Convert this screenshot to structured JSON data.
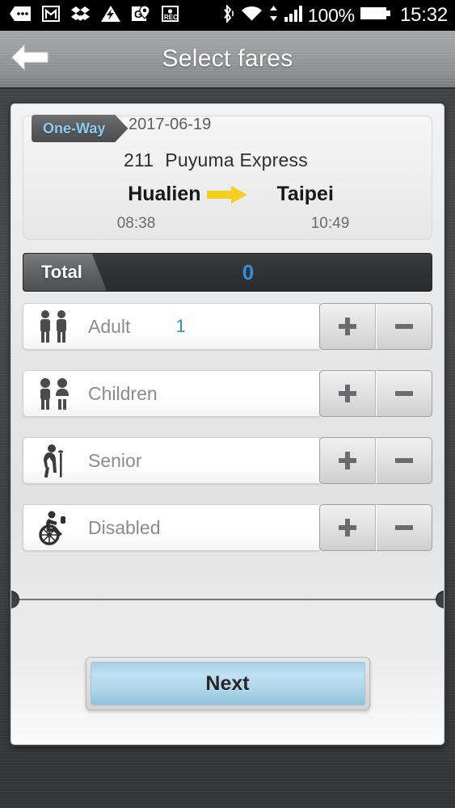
{
  "statusbar": {
    "left_icons": [
      "messages-dots-icon",
      "gmail-icon",
      "dropbox-icon",
      "lightning-triangle-icon",
      "google-maps-pin-icon",
      "rec-icon"
    ],
    "right_icons": [
      "bluetooth-icon",
      "wifi-icon",
      "data-transfer-icon",
      "cellular-signal-icon"
    ],
    "battery_percent": "100%",
    "battery_icon": "battery-full-icon",
    "clock": "15:32"
  },
  "header": {
    "back_icon": "back-arrow-icon",
    "title": "Select fares"
  },
  "trip": {
    "way_tag": "One-Way",
    "date": "2017-06-19",
    "train_number": "211",
    "train_name": "Puyuma Express",
    "from_station": "Hualien",
    "to_station": "Taipei",
    "arrow_icon": "right-arrow-icon",
    "depart_time": "08:38",
    "arrive_time": "10:49"
  },
  "total": {
    "label": "Total",
    "value": "0"
  },
  "fares": {
    "plus_label": "+",
    "minus_label": "−",
    "rows": [
      {
        "label": "Adult",
        "count": "1",
        "icon": "adult-pair-icon"
      },
      {
        "label": "Children",
        "count": "",
        "icon": "children-pair-icon"
      },
      {
        "label": "Senior",
        "count": "",
        "icon": "senior-cane-icon"
      },
      {
        "label": "Disabled",
        "count": "",
        "icon": "wheelchair-icon"
      }
    ]
  },
  "footer": {
    "next_label": "Next"
  },
  "colors": {
    "accent_blue": "#2f8fdd",
    "tag_blue": "#8ecdf2",
    "arrow_yellow": "#f5d021",
    "next_blue": "#b0d7ea"
  }
}
